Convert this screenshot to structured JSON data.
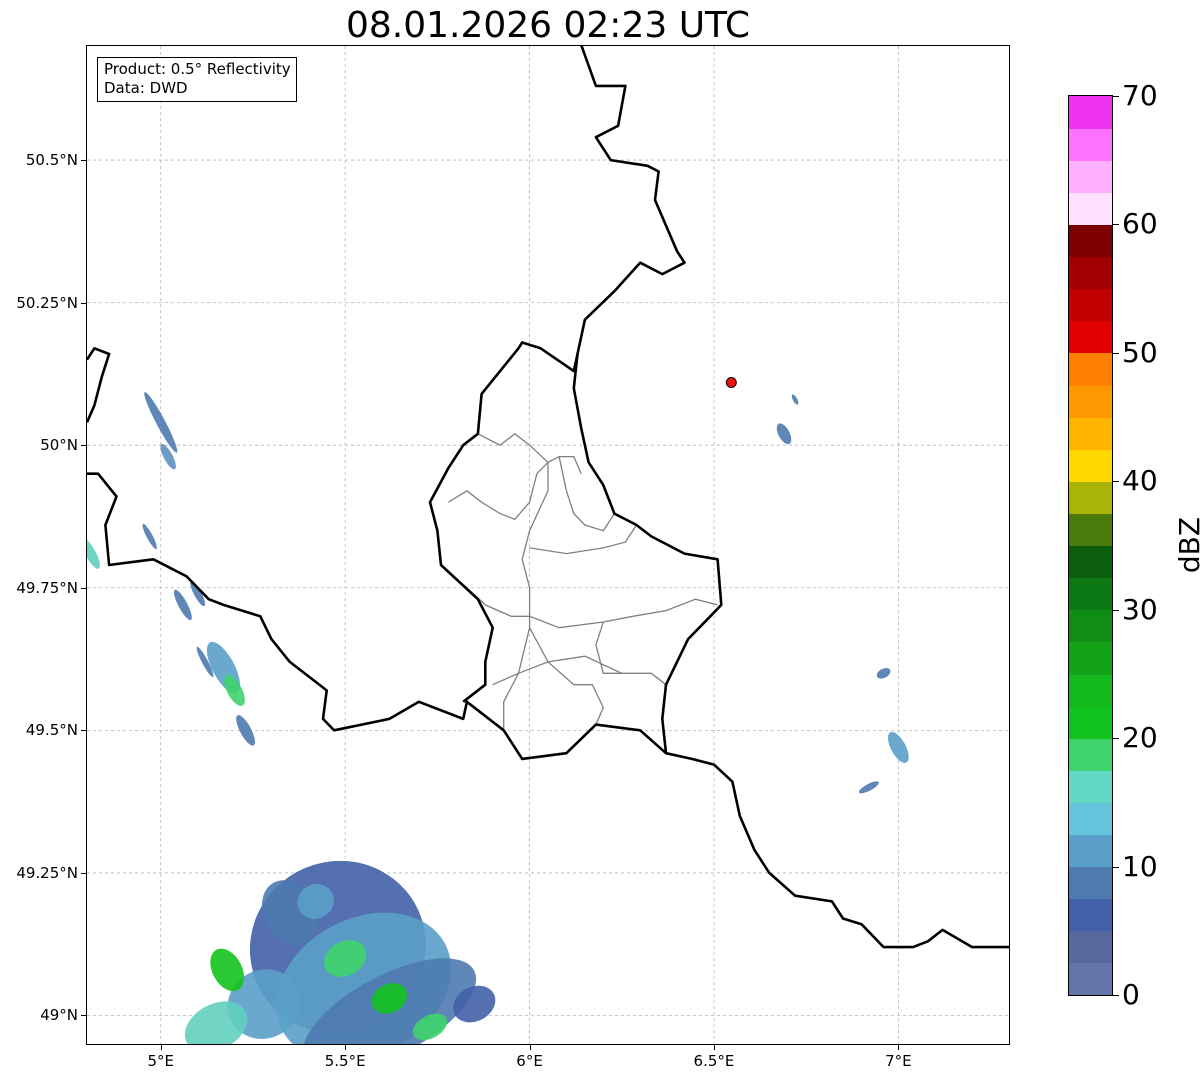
{
  "title": "08.01.2026 02:23 UTC",
  "info": {
    "product": "Product: 0.5° Reflectivity",
    "source": "Data: DWD"
  },
  "map": {
    "lon_range": [
      4.8,
      7.3
    ],
    "lat_range": [
      48.95,
      50.7
    ],
    "lon_ticks": [
      {
        "value": 5.0,
        "label": "5°E"
      },
      {
        "value": 5.5,
        "label": "5.5°E"
      },
      {
        "value": 6.0,
        "label": "6°E"
      },
      {
        "value": 6.5,
        "label": "6.5°E"
      },
      {
        "value": 7.0,
        "label": "7°E"
      }
    ],
    "lat_ticks": [
      {
        "value": 49.0,
        "label": "49°N"
      },
      {
        "value": 49.25,
        "label": "49.25°N"
      },
      {
        "value": 49.5,
        "label": "49.5°N"
      },
      {
        "value": 49.75,
        "label": "49.75°N"
      },
      {
        "value": 50.0,
        "label": "50°N"
      },
      {
        "value": 50.25,
        "label": "50.25°N"
      },
      {
        "value": 50.5,
        "label": "50.5°N"
      }
    ],
    "gridlines": true,
    "marker": {
      "lon": 6.547,
      "lat": 50.11,
      "color": "#ee1111"
    },
    "borders": {
      "national": [
        [
          [
            6.13,
            50.72
          ],
          [
            6.18,
            50.63
          ],
          [
            6.26,
            50.63
          ],
          [
            6.24,
            50.56
          ],
          [
            6.18,
            50.54
          ],
          [
            6.22,
            50.5
          ],
          [
            6.32,
            50.49
          ],
          [
            6.35,
            50.48
          ],
          [
            6.34,
            50.43
          ],
          [
            6.4,
            50.34
          ],
          [
            6.42,
            50.32
          ],
          [
            6.36,
            50.3
          ],
          [
            6.3,
            50.32
          ],
          [
            6.23,
            50.27
          ],
          [
            6.15,
            50.22
          ],
          [
            6.13,
            50.16
          ],
          [
            6.12,
            50.1
          ],
          [
            6.14,
            50.03
          ],
          [
            6.16,
            49.97
          ],
          [
            6.2,
            49.93
          ],
          [
            6.23,
            49.88
          ],
          [
            6.29,
            49.86
          ],
          [
            6.33,
            49.84
          ],
          [
            6.42,
            49.81
          ],
          [
            6.51,
            49.8
          ],
          [
            6.52,
            49.72
          ],
          [
            6.49,
            49.7
          ],
          [
            6.43,
            49.66
          ],
          [
            6.37,
            49.58
          ],
          [
            6.36,
            49.52
          ],
          [
            6.37,
            49.46
          ],
          [
            6.3,
            49.5
          ],
          [
            6.18,
            49.51
          ],
          [
            6.1,
            49.46
          ],
          [
            5.98,
            49.45
          ],
          [
            5.93,
            49.5
          ],
          [
            5.83,
            49.55
          ],
          [
            5.82,
            49.52
          ],
          [
            5.7,
            49.55
          ],
          [
            5.62,
            49.52
          ],
          [
            5.47,
            49.5
          ],
          [
            5.44,
            49.52
          ],
          [
            5.45,
            49.57
          ],
          [
            5.35,
            49.62
          ],
          [
            5.3,
            49.66
          ],
          [
            5.27,
            49.7
          ],
          [
            5.17,
            49.72
          ],
          [
            5.13,
            49.73
          ],
          [
            5.07,
            49.77
          ],
          [
            4.98,
            49.8
          ],
          [
            4.86,
            49.79
          ],
          [
            4.85,
            49.86
          ],
          [
            4.88,
            49.91
          ],
          [
            4.83,
            49.95
          ],
          [
            4.8,
            49.95
          ]
        ],
        [
          [
            6.37,
            49.46
          ],
          [
            6.44,
            49.45
          ],
          [
            6.5,
            49.44
          ],
          [
            6.55,
            49.41
          ],
          [
            6.57,
            49.35
          ],
          [
            6.61,
            49.29
          ],
          [
            6.65,
            49.25
          ],
          [
            6.72,
            49.21
          ],
          [
            6.82,
            49.2
          ],
          [
            6.85,
            49.17
          ],
          [
            6.9,
            49.16
          ],
          [
            6.96,
            49.12
          ],
          [
            7.04,
            49.12
          ],
          [
            7.08,
            49.13
          ],
          [
            7.12,
            49.15
          ],
          [
            7.2,
            49.12
          ],
          [
            7.28,
            49.12
          ],
          [
            7.3,
            49.12
          ]
        ],
        [
          [
            4.8,
            50.15
          ],
          [
            4.82,
            50.17
          ],
          [
            4.86,
            50.16
          ],
          [
            4.84,
            50.12
          ],
          [
            4.82,
            50.07
          ],
          [
            4.8,
            50.04
          ]
        ],
        [
          [
            6.13,
            50.16
          ],
          [
            6.12,
            50.13
          ],
          [
            6.03,
            50.17
          ],
          [
            5.98,
            50.18
          ],
          [
            5.97,
            50.17
          ],
          [
            5.87,
            50.09
          ],
          [
            5.86,
            50.02
          ],
          [
            5.82,
            50.0
          ],
          [
            5.78,
            49.96
          ],
          [
            5.73,
            49.9
          ],
          [
            5.75,
            49.85
          ],
          [
            5.76,
            49.79
          ],
          [
            5.86,
            49.73
          ],
          [
            5.9,
            49.68
          ],
          [
            5.88,
            49.62
          ],
          [
            5.88,
            49.58
          ],
          [
            5.82,
            49.55
          ]
        ]
      ],
      "regional": [
        [
          [
            5.86,
            50.02
          ],
          [
            5.92,
            50.0
          ],
          [
            5.96,
            50.02
          ],
          [
            6.0,
            50.0
          ],
          [
            6.05,
            49.97
          ],
          [
            6.08,
            49.98
          ],
          [
            6.12,
            49.98
          ],
          [
            6.14,
            49.95
          ]
        ],
        [
          [
            5.78,
            49.9
          ],
          [
            5.83,
            49.92
          ],
          [
            5.87,
            49.9
          ],
          [
            5.92,
            49.88
          ],
          [
            5.96,
            49.87
          ],
          [
            6.0,
            49.9
          ],
          [
            6.02,
            49.95
          ],
          [
            6.05,
            49.97
          ]
        ],
        [
          [
            6.05,
            49.97
          ],
          [
            6.05,
            49.92
          ],
          [
            6.0,
            49.85
          ],
          [
            5.98,
            49.8
          ],
          [
            6.0,
            49.75
          ],
          [
            6.0,
            49.68
          ],
          [
            5.97,
            49.6
          ],
          [
            5.93,
            49.55
          ],
          [
            5.93,
            49.5
          ]
        ],
        [
          [
            5.76,
            49.79
          ],
          [
            5.83,
            49.75
          ],
          [
            5.88,
            49.72
          ],
          [
            5.95,
            49.7
          ],
          [
            6.0,
            49.7
          ],
          [
            6.08,
            49.68
          ],
          [
            6.2,
            49.69
          ],
          [
            6.28,
            49.7
          ],
          [
            6.37,
            49.71
          ],
          [
            6.45,
            49.73
          ],
          [
            6.51,
            49.72
          ]
        ],
        [
          [
            6.0,
            49.82
          ],
          [
            6.1,
            49.81
          ],
          [
            6.2,
            49.82
          ],
          [
            6.26,
            49.83
          ],
          [
            6.29,
            49.86
          ]
        ],
        [
          [
            6.08,
            49.98
          ],
          [
            6.1,
            49.92
          ],
          [
            6.12,
            49.88
          ],
          [
            6.15,
            49.86
          ],
          [
            6.2,
            49.85
          ],
          [
            6.23,
            49.88
          ]
        ],
        [
          [
            6.0,
            49.68
          ],
          [
            6.05,
            49.62
          ],
          [
            6.12,
            49.58
          ],
          [
            6.17,
            49.58
          ],
          [
            6.2,
            49.54
          ],
          [
            6.18,
            49.51
          ]
        ],
        [
          [
            5.9,
            49.58
          ],
          [
            5.97,
            49.6
          ],
          [
            6.05,
            49.62
          ],
          [
            6.15,
            49.63
          ],
          [
            6.25,
            49.6
          ],
          [
            6.33,
            49.6
          ],
          [
            6.37,
            49.58
          ]
        ],
        [
          [
            6.2,
            49.69
          ],
          [
            6.18,
            49.65
          ],
          [
            6.2,
            49.6
          ],
          [
            6.25,
            49.6
          ]
        ]
      ]
    },
    "echoes": [
      {
        "lon": 5.0,
        "lat": 50.04,
        "rx": 0.012,
        "ry": 0.06,
        "color": "#4e7ab0"
      },
      {
        "lon": 5.02,
        "lat": 49.98,
        "rx": 0.012,
        "ry": 0.025,
        "color": "#5d91c0"
      },
      {
        "lon": 4.97,
        "lat": 49.84,
        "rx": 0.008,
        "ry": 0.025,
        "color": "#4e7ab0"
      },
      {
        "lon": 4.81,
        "lat": 49.81,
        "rx": 0.014,
        "ry": 0.03,
        "color": "#63cfbf"
      },
      {
        "lon": 5.06,
        "lat": 49.72,
        "rx": 0.012,
        "ry": 0.03,
        "color": "#4e7ab0"
      },
      {
        "lon": 5.17,
        "lat": 49.61,
        "rx": 0.03,
        "ry": 0.05,
        "color": "#5aa0c8"
      },
      {
        "lon": 5.2,
        "lat": 49.57,
        "rx": 0.02,
        "ry": 0.03,
        "color": "#3fd46c"
      },
      {
        "lon": 5.23,
        "lat": 49.5,
        "rx": 0.015,
        "ry": 0.03,
        "color": "#4e7ab0"
      },
      {
        "lon": 5.12,
        "lat": 49.62,
        "rx": 0.008,
        "ry": 0.03,
        "color": "#4e7ab0"
      },
      {
        "lon": 5.1,
        "lat": 49.74,
        "rx": 0.01,
        "ry": 0.025,
        "color": "#4e7ab0"
      },
      {
        "lon": 6.69,
        "lat": 50.02,
        "rx": 0.015,
        "ry": 0.02,
        "color": "#4e7ab0"
      },
      {
        "lon": 6.72,
        "lat": 50.08,
        "rx": 0.006,
        "ry": 0.01,
        "color": "#4e7ab0"
      },
      {
        "lon": 6.96,
        "lat": 49.6,
        "rx": 0.02,
        "ry": 0.008,
        "color": "#4e7ab0"
      },
      {
        "lon": 7.0,
        "lat": 49.47,
        "rx": 0.02,
        "ry": 0.03,
        "color": "#5aa0c8"
      },
      {
        "lon": 6.92,
        "lat": 49.4,
        "rx": 0.03,
        "ry": 0.006,
        "color": "#4e7ab0"
      },
      {
        "lon": 5.48,
        "lat": 49.12,
        "rx": 0.24,
        "ry": 0.15,
        "color": "#4361a8"
      },
      {
        "lon": 5.55,
        "lat": 49.05,
        "rx": 0.25,
        "ry": 0.12,
        "color": "#5aa0c8"
      },
      {
        "lon": 5.62,
        "lat": 49.0,
        "rx": 0.26,
        "ry": 0.07,
        "color": "#4e7ab0"
      },
      {
        "lon": 5.28,
        "lat": 49.02,
        "rx": 0.1,
        "ry": 0.06,
        "color": "#5aa0c8"
      },
      {
        "lon": 5.15,
        "lat": 48.98,
        "rx": 0.09,
        "ry": 0.04,
        "color": "#63cfbf"
      },
      {
        "lon": 5.35,
        "lat": 49.18,
        "rx": 0.07,
        "ry": 0.06,
        "color": "#4e7ab0"
      },
      {
        "lon": 5.5,
        "lat": 49.1,
        "rx": 0.06,
        "ry": 0.03,
        "color": "#3fd46c"
      },
      {
        "lon": 5.62,
        "lat": 49.03,
        "rx": 0.05,
        "ry": 0.025,
        "color": "#13c31d"
      },
      {
        "lon": 5.73,
        "lat": 48.98,
        "rx": 0.05,
        "ry": 0.02,
        "color": "#3fd46c"
      },
      {
        "lon": 5.18,
        "lat": 49.08,
        "rx": 0.04,
        "ry": 0.04,
        "color": "#13c31d"
      },
      {
        "lon": 5.42,
        "lat": 49.2,
        "rx": 0.05,
        "ry": 0.03,
        "color": "#5aa0c8"
      },
      {
        "lon": 5.85,
        "lat": 49.02,
        "rx": 0.06,
        "ry": 0.03,
        "color": "#4361a8"
      }
    ]
  },
  "colorbar": {
    "label": "dBZ",
    "min": 0,
    "max": 70,
    "step": 2.5,
    "ticks": [
      {
        "value": 0,
        "label": "0"
      },
      {
        "value": 10,
        "label": "10"
      },
      {
        "value": 20,
        "label": "20"
      },
      {
        "value": 30,
        "label": "30"
      },
      {
        "value": 40,
        "label": "40"
      },
      {
        "value": 50,
        "label": "50"
      },
      {
        "value": 60,
        "label": "60"
      },
      {
        "value": 70,
        "label": "70"
      }
    ],
    "colors": [
      "#6474a8",
      "#56689e",
      "#4361a8",
      "#4e7ab0",
      "#5aa0c8",
      "#66c4dd",
      "#63d8c5",
      "#3fd46c",
      "#13c31d",
      "#13b81d",
      "#12a318",
      "#0f8d14",
      "#0b7813",
      "#0a5e0d",
      "#4a7a0a",
      "#aab408",
      "#ffd800",
      "#ffb400",
      "#ff9800",
      "#ff7f00",
      "#e30000",
      "#c10000",
      "#a20000",
      "#7d0000",
      "#ffe1ff",
      "#ffb1ff",
      "#ff71ff",
      "#ed33ed"
    ]
  }
}
